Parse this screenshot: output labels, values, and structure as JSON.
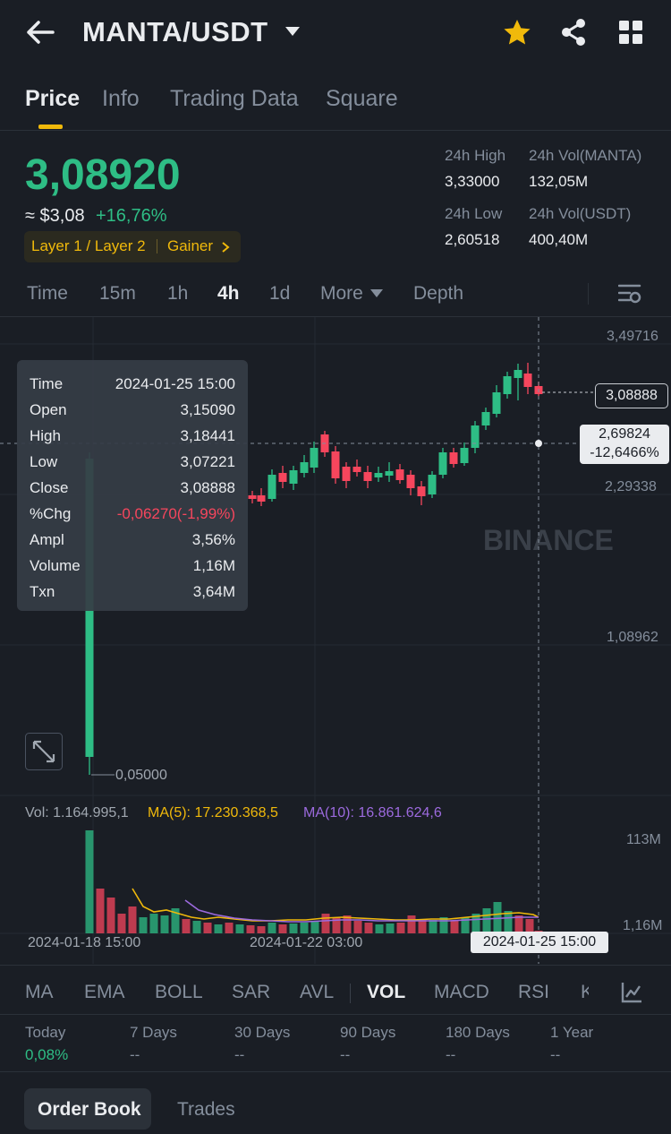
{
  "header": {
    "pair": "MANTA/USDT"
  },
  "tabs": [
    {
      "label": "Price"
    },
    {
      "label": "Info"
    },
    {
      "label": "Trading Data"
    },
    {
      "label": "Square"
    }
  ],
  "price": {
    "last": "3,08920",
    "fiat": "≈ $3,08",
    "change": "+16,76%",
    "tags": [
      "Layer 1 / Layer 2",
      "Gainer"
    ],
    "stats": {
      "high_label": "24h High",
      "high": "3,33000",
      "vol_base_label": "24h Vol(MANTA)",
      "vol_base": "132,05M",
      "low_label": "24h Low",
      "low": "2,60518",
      "vol_quote_label": "24h Vol(USDT)",
      "vol_quote": "400,40M"
    }
  },
  "intervals": [
    "Time",
    "15m",
    "1h",
    "4h",
    "1d",
    "More",
    "Depth"
  ],
  "chart": {
    "y_labels": [
      "3,49716",
      "2,29338",
      "1,08962"
    ],
    "min_label": "0,05000",
    "last_price_tag": "3,08888",
    "crosshair_price": "2,69824",
    "crosshair_pct": "-12,6466%",
    "watermark": "BINANCE",
    "tooltip": [
      {
        "k": "Time",
        "v": "2024-01-25 15:00"
      },
      {
        "k": "Open",
        "v": "3,15090"
      },
      {
        "k": "High",
        "v": "3,18441"
      },
      {
        "k": "Low",
        "v": "3,07221"
      },
      {
        "k": "Close",
        "v": "3,08888"
      },
      {
        "k": "%Chg",
        "v": "-0,06270(-1,99%)"
      },
      {
        "k": "Ampl",
        "v": "3,56%"
      },
      {
        "k": "Volume",
        "v": "1,16M"
      },
      {
        "k": "Txn",
        "v": "3,64M"
      }
    ]
  },
  "volume": {
    "vol": "Vol: 1.164.995,1",
    "ma5": "MA(5): 17.230.368,5",
    "ma10": "MA(10): 16.861.624,6",
    "y_top": "113M",
    "y_bottom": "1,16M",
    "dates": [
      "2024-01-18 15:00",
      "2024-01-22 03:00"
    ],
    "crosshair_date": "2024-01-25 15:00"
  },
  "indicators": [
    "MA",
    "EMA",
    "BOLL",
    "SAR",
    "AVL",
    "VOL",
    "MACD",
    "RSI",
    "K"
  ],
  "performance": [
    {
      "label": "Today",
      "value": "0,08%"
    },
    {
      "label": "7 Days",
      "value": "--"
    },
    {
      "label": "30 Days",
      "value": "--"
    },
    {
      "label": "90 Days",
      "value": "--"
    },
    {
      "label": "180 Days",
      "value": "--"
    },
    {
      "label": "1 Year",
      "value": "--"
    }
  ],
  "bottom_tabs": [
    "Order Book",
    "Trades"
  ],
  "colors": {
    "up": "#2ebd85",
    "down": "#f6465d",
    "accent": "#f0b90b",
    "ma5": "#f0b90b",
    "ma10": "#9c6ade"
  }
}
